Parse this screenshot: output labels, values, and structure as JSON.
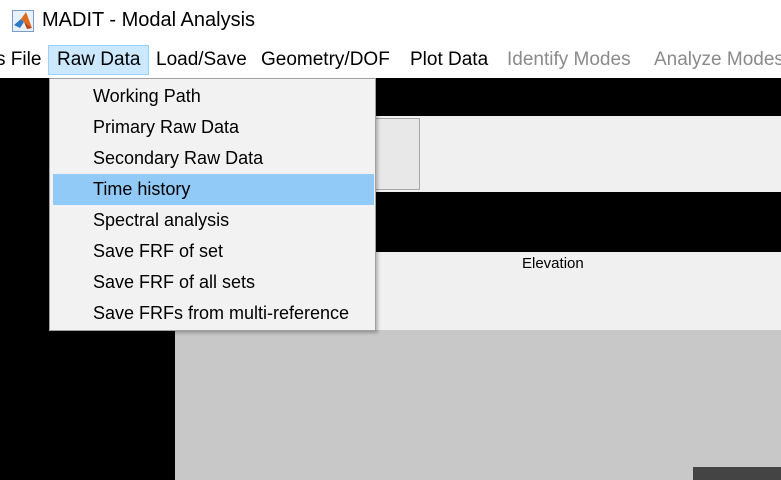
{
  "window": {
    "title": "MADIT - Modal Analysis",
    "icon": "matlab-logo-icon"
  },
  "menubar": {
    "items": [
      {
        "label": "s File",
        "enabled": true
      },
      {
        "label": "Raw Data",
        "enabled": true,
        "active": true
      },
      {
        "label": "Load/Save",
        "enabled": true
      },
      {
        "label": "Geometry/DOF",
        "enabled": true
      },
      {
        "label": "Plot Data",
        "enabled": true
      },
      {
        "label": "Identify Modes",
        "enabled": false
      },
      {
        "label": "Analyze Modes",
        "enabled": false
      }
    ]
  },
  "raw_data_menu": {
    "items": [
      {
        "label": "Working Path"
      },
      {
        "label": "Primary Raw Data"
      },
      {
        "label": "Secondary Raw Data"
      },
      {
        "label": "Time history",
        "highlighted": true
      },
      {
        "label": "Spectral analysis"
      },
      {
        "label": "Save FRF of set"
      },
      {
        "label": "Save FRF of all sets"
      },
      {
        "label": "Save FRFs from multi-reference"
      }
    ]
  },
  "figure": {
    "elevation_label": "Elevation"
  },
  "colors": {
    "menu_active_bg": "#cce8ff",
    "dropdown_highlight": "#91c9f7",
    "disabled_text": "#8a8a8a"
  }
}
